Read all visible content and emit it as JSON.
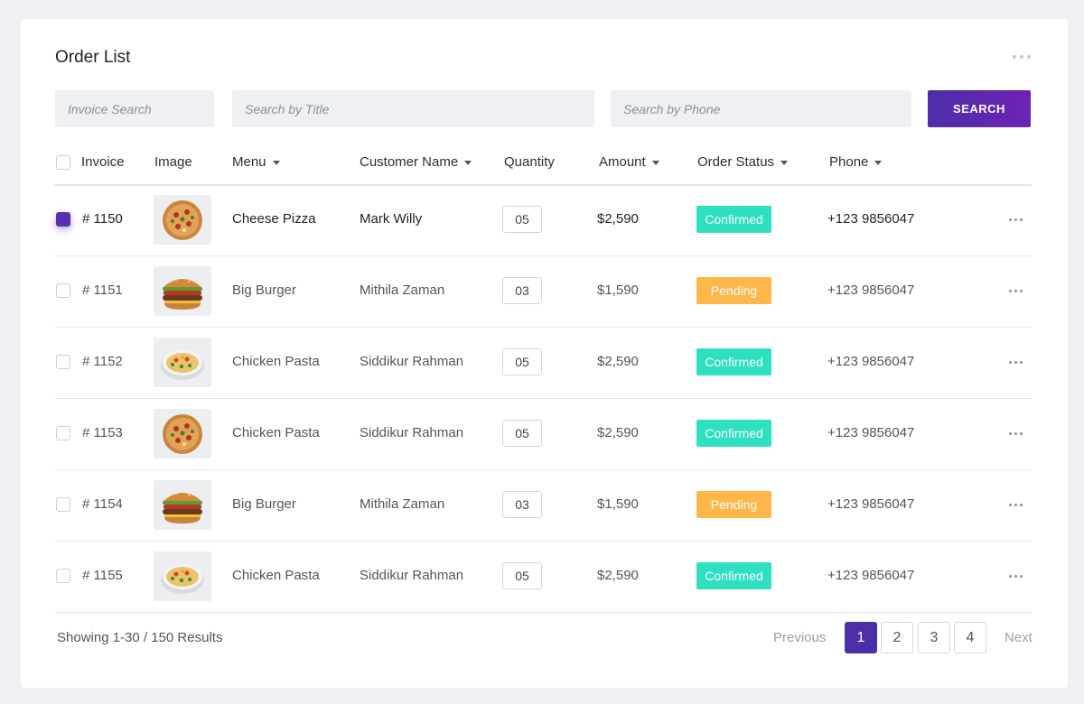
{
  "title": "Order List",
  "filters": {
    "invoice_placeholder": "Invoice Search",
    "title_placeholder": "Search by Title",
    "phone_placeholder": "Search by Phone",
    "search_label": "SEARCH"
  },
  "columns": {
    "invoice": "Invoice",
    "image": "Image",
    "menu": "Menu",
    "customer": "Customer Name",
    "quantity": "Quantity",
    "amount": "Amount",
    "status": "Order Status",
    "phone": "Phone"
  },
  "rows": [
    {
      "invoice": "# 1150",
      "image": "pizza-image",
      "menu": "Cheese Pizza",
      "customer": "Mark Willy",
      "quantity": "05",
      "amount": "$2,590",
      "status": "Confirmed",
      "phone": "+123 9856047",
      "checked": true
    },
    {
      "invoice": "# 1151",
      "image": "burger-image",
      "menu": "Big Burger",
      "customer": "Mithila Zaman",
      "quantity": "03",
      "amount": "$1,590",
      "status": "Pending",
      "phone": "+123 9856047",
      "checked": false
    },
    {
      "invoice": "# 1152",
      "image": "pasta-image",
      "menu": "Chicken Pasta",
      "customer": "Siddikur Rahman",
      "quantity": "05",
      "amount": "$2,590",
      "status": "Confirmed",
      "phone": "+123 9856047",
      "checked": false
    },
    {
      "invoice": "# 1153",
      "image": "pizza-image",
      "menu": "Chicken Pasta",
      "customer": "Siddikur Rahman",
      "quantity": "05",
      "amount": "$2,590",
      "status": "Confirmed",
      "phone": "+123 9856047",
      "checked": false
    },
    {
      "invoice": "# 1154",
      "image": "burger-image",
      "menu": "Big Burger",
      "customer": "Mithila Zaman",
      "quantity": "03",
      "amount": "$1,590",
      "status": "Pending",
      "phone": "+123 9856047",
      "checked": false
    },
    {
      "invoice": "# 1155",
      "image": "pasta-image",
      "menu": "Chicken Pasta",
      "customer": "Siddikur Rahman",
      "quantity": "05",
      "amount": "$2,590",
      "status": "Confirmed",
      "phone": "+123 9856047",
      "checked": false
    }
  ],
  "footer": {
    "results_text": "Showing 1-30 / 150 Results",
    "previous": "Previous",
    "next": "Next",
    "pages": [
      "1",
      "2",
      "3",
      "4"
    ],
    "current_page": "1"
  },
  "colors": {
    "accent": "#4b2ea8",
    "confirmed": "#2ee0c0",
    "pending": "#ffb74a"
  }
}
